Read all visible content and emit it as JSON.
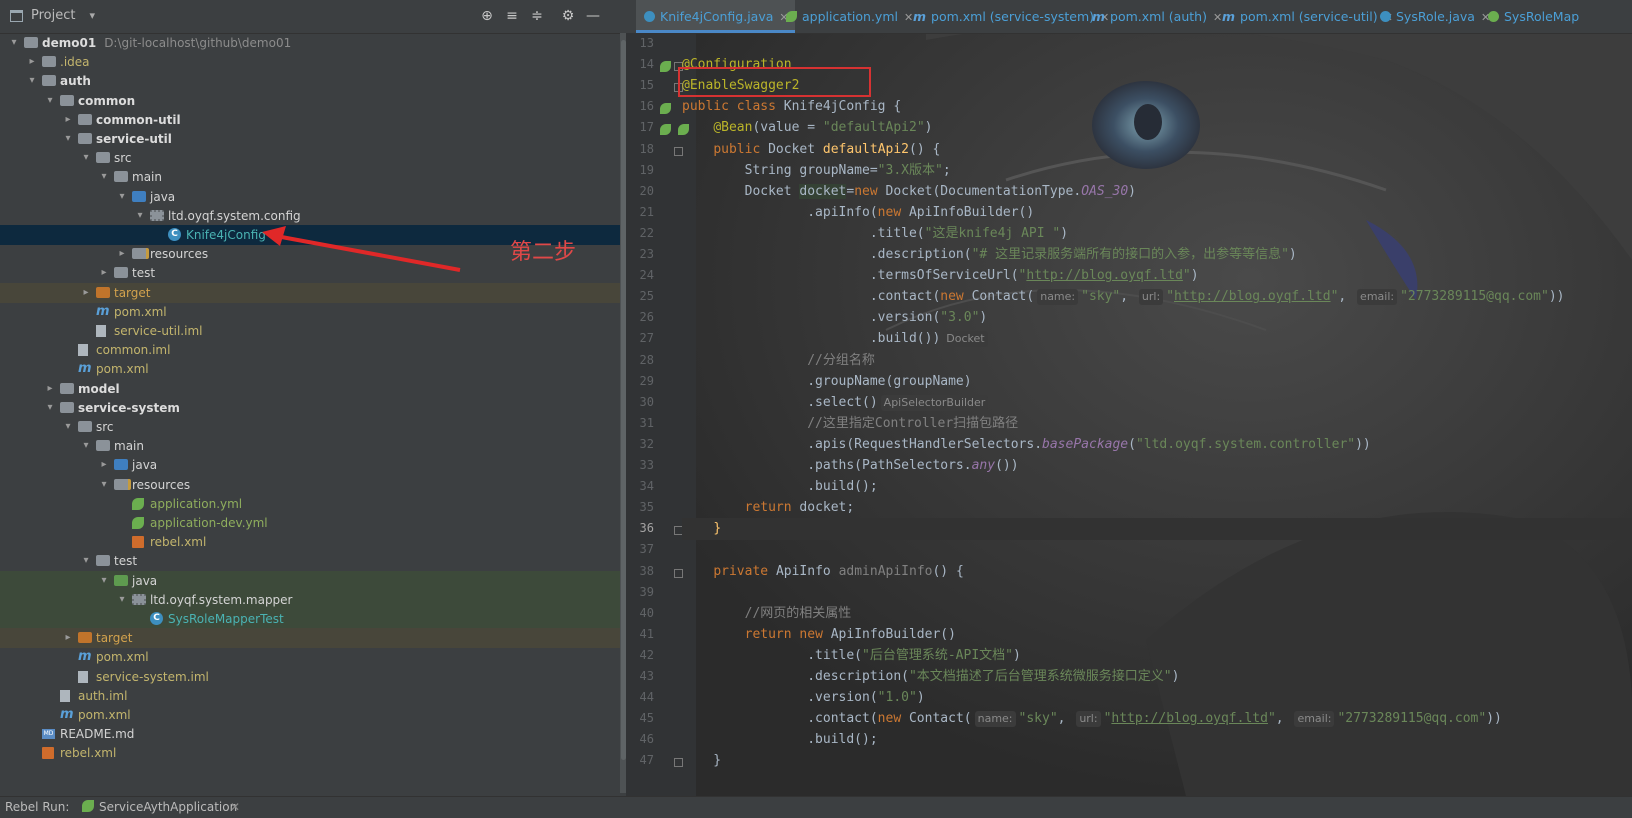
{
  "project_panel": {
    "title": "Project",
    "tree": [
      {
        "label": "demo01",
        "path": "D:\\git-localhost\\github\\demo01",
        "kind": "folder-module",
        "depth": 0,
        "expanded": true,
        "style": "bold"
      },
      {
        "label": ".idea",
        "kind": "folder",
        "depth": 1,
        "expanded": false,
        "style": "y"
      },
      {
        "label": "auth",
        "kind": "folder-module",
        "depth": 1,
        "expanded": true,
        "style": "bold"
      },
      {
        "label": "common",
        "kind": "folder-module",
        "depth": 2,
        "expanded": true,
        "style": "bold"
      },
      {
        "label": "common-util",
        "kind": "folder-module",
        "depth": 3,
        "expanded": false,
        "style": "bold"
      },
      {
        "label": "service-util",
        "kind": "folder-module",
        "depth": 3,
        "expanded": true,
        "style": "bold"
      },
      {
        "label": "src",
        "kind": "folder",
        "depth": 4,
        "expanded": true,
        "style": "w"
      },
      {
        "label": "main",
        "kind": "folder",
        "depth": 5,
        "expanded": true,
        "style": "w"
      },
      {
        "label": "java",
        "kind": "folder-blue",
        "depth": 6,
        "expanded": true,
        "style": "w"
      },
      {
        "label": "ltd.oyqf.system.config",
        "kind": "package",
        "depth": 7,
        "expanded": true,
        "style": "w"
      },
      {
        "label": "Knife4jConfig",
        "kind": "class",
        "depth": 8,
        "style": "t",
        "selected": true
      },
      {
        "label": "resources",
        "kind": "folder-res",
        "depth": 6,
        "expanded": false,
        "style": "w"
      },
      {
        "label": "test",
        "kind": "folder",
        "depth": 5,
        "expanded": false,
        "style": "w"
      },
      {
        "label": "target",
        "kind": "folder-orange",
        "depth": 4,
        "expanded": false,
        "style": "o",
        "generated": true
      },
      {
        "label": "pom.xml",
        "kind": "maven",
        "depth": 4,
        "style": "y"
      },
      {
        "label": "service-util.iml",
        "kind": "iml",
        "depth": 4,
        "style": "y"
      },
      {
        "label": "common.iml",
        "kind": "iml",
        "depth": 3,
        "style": "y"
      },
      {
        "label": "pom.xml",
        "kind": "maven",
        "depth": 3,
        "style": "y"
      },
      {
        "label": "model",
        "kind": "folder-module",
        "depth": 2,
        "expanded": false,
        "style": "bold"
      },
      {
        "label": "service-system",
        "kind": "folder-module",
        "depth": 2,
        "expanded": true,
        "style": "bold"
      },
      {
        "label": "src",
        "kind": "folder",
        "depth": 3,
        "expanded": true,
        "style": "w"
      },
      {
        "label": "main",
        "kind": "folder",
        "depth": 4,
        "expanded": true,
        "style": "w"
      },
      {
        "label": "java",
        "kind": "folder-blue",
        "depth": 5,
        "expanded": false,
        "style": "w"
      },
      {
        "label": "resources",
        "kind": "folder-res",
        "depth": 5,
        "expanded": true,
        "style": "w"
      },
      {
        "label": "application.yml",
        "kind": "spring",
        "depth": 6,
        "style": "g"
      },
      {
        "label": "application-dev.yml",
        "kind": "spring",
        "depth": 6,
        "style": "g"
      },
      {
        "label": "rebel.xml",
        "kind": "xml",
        "depth": 6,
        "style": "y"
      },
      {
        "label": "test",
        "kind": "folder",
        "depth": 4,
        "expanded": true,
        "style": "w"
      },
      {
        "label": "java",
        "kind": "folder-green",
        "depth": 5,
        "expanded": true,
        "style": "w",
        "test": true
      },
      {
        "label": "ltd.oyqf.system.mapper",
        "kind": "package",
        "depth": 6,
        "expanded": true,
        "style": "w",
        "test": true
      },
      {
        "label": "SysRoleMapperTest",
        "kind": "class",
        "depth": 7,
        "style": "t",
        "test": true
      },
      {
        "label": "target",
        "kind": "folder-orange",
        "depth": 3,
        "expanded": false,
        "style": "o",
        "generated": true
      },
      {
        "label": "pom.xml",
        "kind": "maven",
        "depth": 3,
        "style": "y"
      },
      {
        "label": "service-system.iml",
        "kind": "iml",
        "depth": 3,
        "style": "y"
      },
      {
        "label": "auth.iml",
        "kind": "iml",
        "depth": 2,
        "style": "y"
      },
      {
        "label": "pom.xml",
        "kind": "maven",
        "depth": 2,
        "style": "y"
      },
      {
        "label": "README.md",
        "kind": "md",
        "depth": 1,
        "style": "w"
      },
      {
        "label": "rebel.xml",
        "kind": "xml",
        "depth": 1,
        "style": "y"
      }
    ]
  },
  "annotation": {
    "text": "第二步",
    "color": "#e04848"
  },
  "tabs": [
    {
      "label": "Knife4jConfig.java",
      "icon": "class-icon",
      "active": true
    },
    {
      "label": "application.yml",
      "icon": "spring-icon"
    },
    {
      "label": "pom.xml (service-system)",
      "icon": "maven-icon"
    },
    {
      "label": "pom.xml (auth)",
      "icon": "maven-icon"
    },
    {
      "label": "pom.xml (service-util)",
      "icon": "maven-icon"
    },
    {
      "label": "SysRole.java",
      "icon": "class-icon"
    },
    {
      "label": "SysRoleMap",
      "icon": "class-icon-green"
    }
  ],
  "code": {
    "first_line": 13,
    "current_line": 36,
    "lines": [
      {
        "n": 13,
        "html": ""
      },
      {
        "n": 14,
        "html": "<span class=\"an\">@Configuration</span>"
      },
      {
        "n": 15,
        "html": "<span class=\"an\">@EnableSwagger2</span>"
      },
      {
        "n": 16,
        "html": "<span class=\"k\">public class </span>Knife4jConfig {"
      },
      {
        "n": 17,
        "html": "    <span class=\"an\">@Bean</span>(value = <span class=\"s\">\"defaultApi2\"</span>)"
      },
      {
        "n": 18,
        "html": "    <span class=\"k\">public </span>Docket <span class=\"fn\">defaultApi2</span>() {"
      },
      {
        "n": 19,
        "html": "        String groupName=<span class=\"s\">\"3.X版本\"</span>;"
      },
      {
        "n": 20,
        "html": "        Docket <span class=\"hl\">docket</span>=<span class=\"k\">new </span>Docket(DocumentationType.<span class=\"it\">OAS_30</span>)"
      },
      {
        "n": 21,
        "html": "                .apiInfo(<span class=\"k\">new </span>ApiInfoBuilder()"
      },
      {
        "n": 22,
        "html": "                        .title(<span class=\"s\">\"这是knife4j API \"</span>)"
      },
      {
        "n": 23,
        "html": "                        .description(<span class=\"s\">\"# 这里记录服务端所有的接口的入参，出参等等信息\"</span>)"
      },
      {
        "n": 24,
        "html": "                        .termsOfServiceUrl(<span class=\"s\">\"<span class=\"ul\">http://blog.oyqf.ltd</span>\"</span>)"
      },
      {
        "n": 25,
        "html": "                        .contact(<span class=\"k\">new </span>Contact(<span class=\"hint\">name:</span><span class=\"s\">\"sky\"</span>, <span class=\"hint\">url:</span><span class=\"s\">\"<span class=\"ul\">http://blog.oyqf.ltd</span>\"</span>, <span class=\"hint\">email:</span><span class=\"s\">\"2773289115@qq.com\"</span>))"
      },
      {
        "n": 26,
        "html": "                        .version(<span class=\"s\">\"3.0\"</span>)"
      },
      {
        "n": 27,
        "html": "                        .build())<span class=\"hint\">Docket</span>"
      },
      {
        "n": 28,
        "html": "                <span class=\"cm\">//分组名称</span>"
      },
      {
        "n": 29,
        "html": "                .groupName(groupName)"
      },
      {
        "n": 30,
        "html": "                .select()<span class=\"hint\">ApiSelectorBuilder</span>"
      },
      {
        "n": 31,
        "html": "                <span class=\"cm\">//这里指定Controller扫描包路径</span>"
      },
      {
        "n": 32,
        "html": "                .apis(RequestHandlerSelectors.<span class=\"it\">basePackage</span>(<span class=\"s\">\"ltd.oyqf.system.controller\"</span>))"
      },
      {
        "n": 33,
        "html": "                .paths(PathSelectors.<span class=\"it\">any</span>())"
      },
      {
        "n": 34,
        "html": "                .build();"
      },
      {
        "n": 35,
        "html": "        <span class=\"k\">return </span>docket;"
      },
      {
        "n": 36,
        "html": "    <span class=\"fn\">}</span>"
      },
      {
        "n": 37,
        "html": ""
      },
      {
        "n": 38,
        "html": "    <span class=\"k\">private </span>ApiInfo <span class=\"cm\">adminApiInfo</span>() {"
      },
      {
        "n": 39,
        "html": ""
      },
      {
        "n": 40,
        "html": "        <span class=\"cm\">//网页的相关属性</span>"
      },
      {
        "n": 41,
        "html": "        <span class=\"k\">return new </span>ApiInfoBuilder()"
      },
      {
        "n": 42,
        "html": "                .title(<span class=\"s\">\"后台管理系统-API文档\"</span>)"
      },
      {
        "n": 43,
        "html": "                .description(<span class=\"s\">\"本文档描述了后台管理系统微服务接口定义\"</span>)"
      },
      {
        "n": 44,
        "html": "                .version(<span class=\"s\">\"1.0\"</span>)"
      },
      {
        "n": 45,
        "html": "                .contact(<span class=\"k\">new </span>Contact(<span class=\"hint\">name:</span><span class=\"s\">\"sky\"</span>, <span class=\"hint\">url:</span><span class=\"s\">\"<span class=\"ul\">http://blog.oyqf.ltd</span>\"</span>, <span class=\"hint\">email:</span><span class=\"s\">\"2773289115@qq.com\"</span>))"
      },
      {
        "n": 46,
        "html": "                .build();"
      },
      {
        "n": 47,
        "html": "    }"
      }
    ]
  },
  "status_bar": {
    "label": "Rebel Run:",
    "app": "ServiceAythApplication"
  }
}
